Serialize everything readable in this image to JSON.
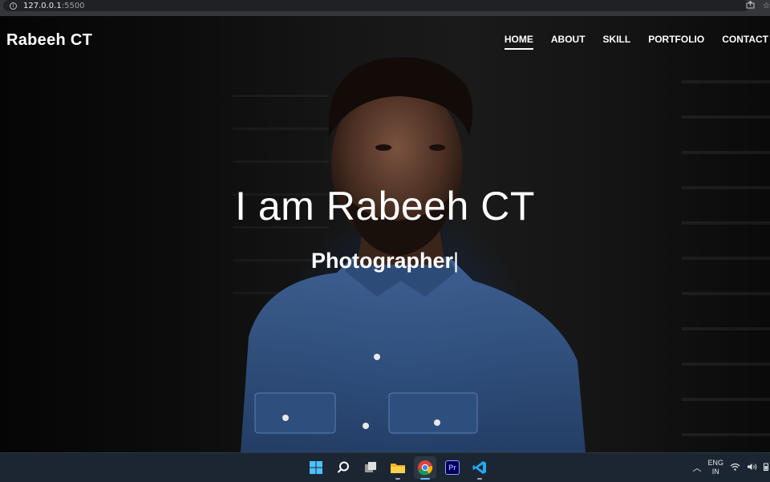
{
  "browser": {
    "url_host": "127.0.0.1",
    "url_port": ":5500",
    "icons": [
      "info-icon",
      "share-icon",
      "bookmark-star-icon"
    ]
  },
  "site": {
    "brand": "Rabeeh CT",
    "nav": [
      {
        "label": "HOME",
        "active": true
      },
      {
        "label": "ABOUT",
        "active": false
      },
      {
        "label": "SKILL",
        "active": false
      },
      {
        "label": "PORTFOLIO",
        "active": false
      },
      {
        "label": "CONTACT",
        "active": false
      }
    ],
    "hero_title": "I am Rabeeh CT",
    "hero_subtitle": "Photographer",
    "hero_cursor": "|"
  },
  "taskbar": {
    "apps": [
      "windows-start-icon",
      "search-icon",
      "task-view-icon",
      "file-explorer-icon",
      "chrome-icon",
      "premiere-pro-icon",
      "vscode-icon"
    ],
    "premiere_label": "Pr",
    "language_line1": "ENG",
    "language_line2": "IN",
    "tray_icons": [
      "chevron-up-icon",
      "wifi-icon",
      "volume-icon",
      "battery-icon"
    ]
  },
  "colors": {
    "taskbar": "#1c2633",
    "accent_blue": "#6cb8ff"
  }
}
